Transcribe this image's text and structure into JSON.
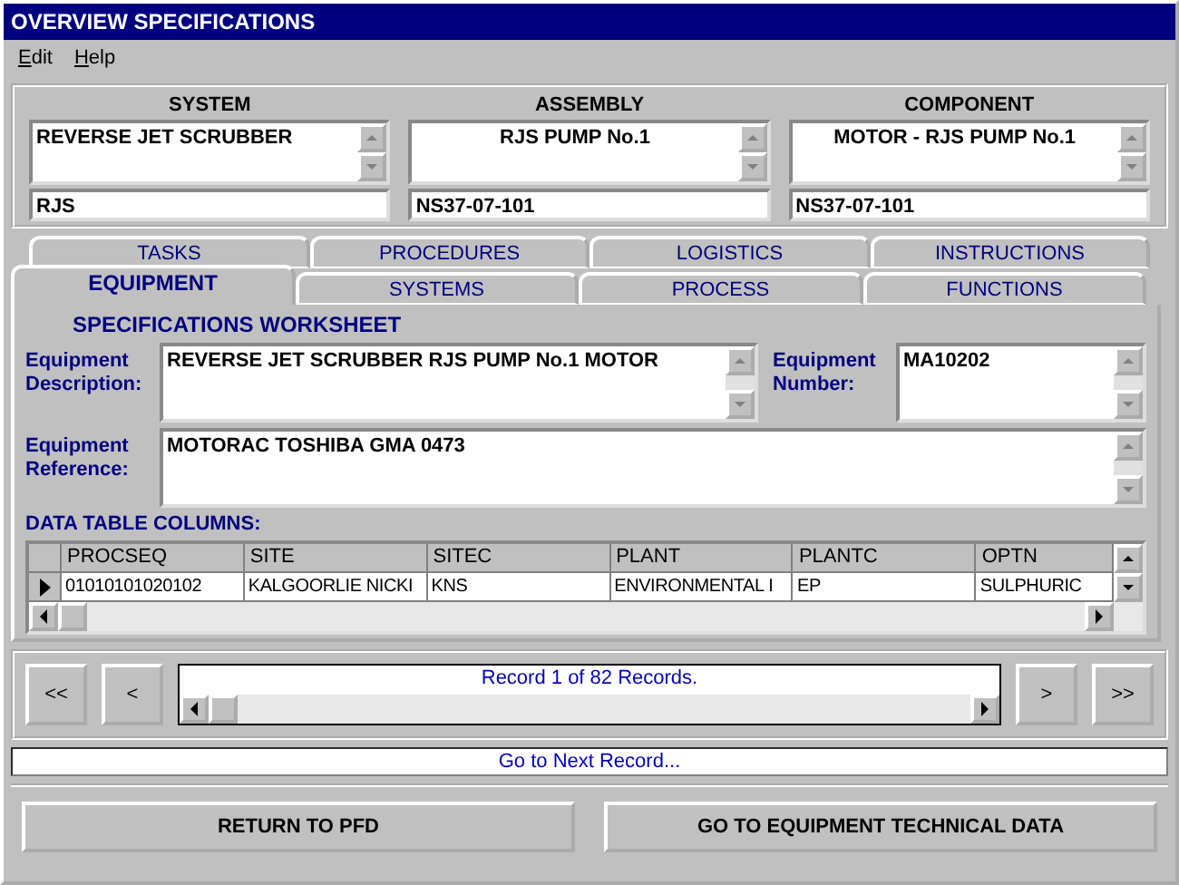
{
  "window": {
    "title": "OVERVIEW SPECIFICATIONS"
  },
  "menu": [
    "Edit",
    "Help"
  ],
  "header": [
    {
      "label": "SYSTEM",
      "name": "REVERSE JET SCRUBBER",
      "centered": false,
      "code": "RJS"
    },
    {
      "label": "ASSEMBLY",
      "name": "RJS PUMP No.1",
      "centered": true,
      "code": "NS37-07-101"
    },
    {
      "label": "COMPONENT",
      "name": "MOTOR -  RJS PUMP No.1",
      "centered": true,
      "code": "NS37-07-101"
    }
  ],
  "tab_rows": [
    [
      {
        "label": "TASKS",
        "selected": false
      },
      {
        "label": "PROCEDURES",
        "selected": false
      },
      {
        "label": "LOGISTICS",
        "selected": false
      },
      {
        "label": "INSTRUCTIONS",
        "selected": false
      }
    ],
    [
      {
        "label": "EQUIPMENT",
        "selected": true
      },
      {
        "label": "SYSTEMS",
        "selected": false
      },
      {
        "label": "PROCESS",
        "selected": false
      },
      {
        "label": "FUNCTIONS",
        "selected": false
      }
    ]
  ],
  "worksheet": {
    "title": "SPECIFICATIONS WORKSHEET",
    "description": {
      "label": "Equipment Description:",
      "value": "REVERSE JET SCRUBBER RJS PUMP No.1 MOTOR"
    },
    "number": {
      "label": "Equipment Number:",
      "value": "MA10202"
    },
    "reference": {
      "label": "Equipment Reference:",
      "value": "MOTORAC TOSHIBA GMA 0473"
    }
  },
  "table": {
    "title": "DATA TABLE COLUMNS:",
    "columns": [
      "PROCSEQ",
      "SITE",
      "SITEC",
      "PLANT",
      "PLANTC",
      "OPTN"
    ],
    "rows": [
      {
        "selected": true,
        "cells": [
          "01010101020102",
          "KALGOORLIE NICKI",
          "KNS",
          "ENVIRONMENTAL I",
          "EP",
          "SULPHURIC"
        ]
      }
    ]
  },
  "navigator": {
    "first": "<<",
    "prev": "<",
    "record": "Record 1 of 82 Records.",
    "next": ">",
    "last": ">>"
  },
  "status": "Go to Next Record...",
  "buttons": [
    "RETURN TO PFD",
    "GO TO EQUIPMENT TECHNICAL DATA"
  ]
}
